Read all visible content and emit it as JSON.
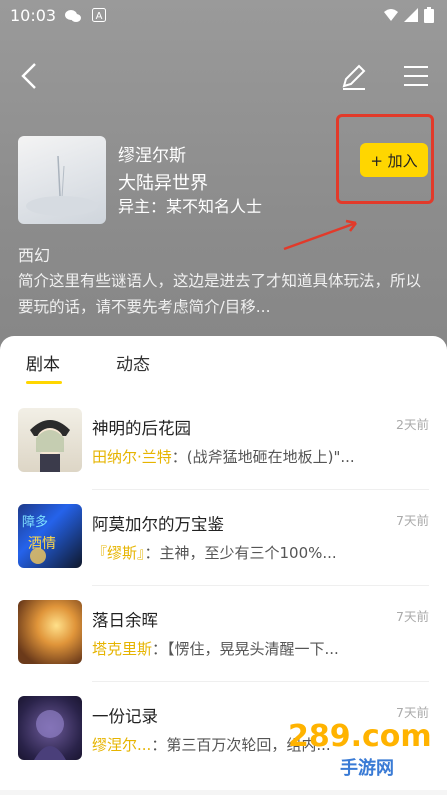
{
  "status_bar": {
    "time": "10:03"
  },
  "book": {
    "author": "缪涅尔斯",
    "world_title": "大陆异世界",
    "owner_label": "异主：某不知名人士",
    "genre": "西幻",
    "description": "简介这里有些谜语人，这边是进去了才知道具体玩法，所以要玩的话，请不要先考虑简介/目移..."
  },
  "join_button": {
    "label": "+ 加入"
  },
  "tabs": [
    {
      "label": "剧本"
    },
    {
      "label": "动态"
    }
  ],
  "scripts": [
    {
      "title": "神明的后花园",
      "time": "2天前",
      "name": "田纳尔·兰特",
      "text": "：(战斧猛地砸在地板上)\"..."
    },
    {
      "title": "阿莫加尔的万宝鉴",
      "time": "7天前",
      "name": "『缪斯』",
      "text": "：主神，至少有三个100%..."
    },
    {
      "title": "落日余晖",
      "time": "7天前",
      "name": "塔克里斯",
      "text": "：【愣住，晃晃头清醒一下..."
    },
    {
      "title": "一份记录",
      "time": "7天前",
      "name": "缪涅尔...",
      "text": "：第三百万次轮回，组内..."
    }
  ],
  "thumb_texts": {
    "thumb2_line1": "障多",
    "thumb2_line2": "酒情"
  },
  "watermark": {
    "text": "289.com",
    "sub": "手游网"
  },
  "colors": {
    "accent": "#ffd600",
    "highlight": "#e23a2a",
    "name_gold": "#e6b400"
  }
}
